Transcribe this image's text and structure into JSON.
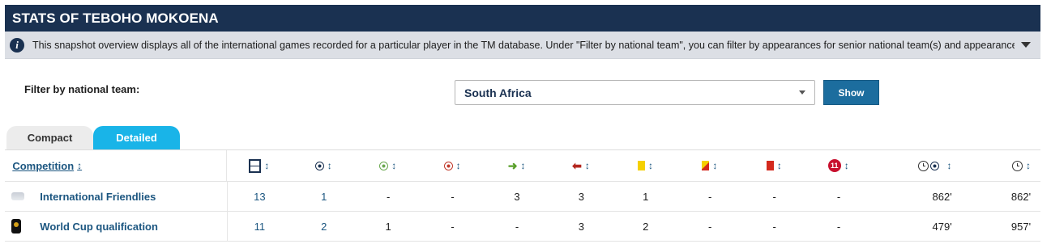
{
  "title": "STATS OF TEBOHO MOKOENA",
  "info": "This snapshot overview displays all of the international games recorded for a particular player in the TM database. Under \"Filter by national team\", you can filter by appearances for senior national team(s) and appearances ...",
  "filter": {
    "label": "Filter by national team:",
    "selected": "South Africa",
    "button": "Show"
  },
  "tabs": {
    "compact": "Compact",
    "detailed": "Detailed"
  },
  "table": {
    "competition_header": "Competition",
    "sort_glyph": "↕",
    "column_icons": [
      "appearances-icon",
      "goals-icon",
      "assists-icon",
      "own-goals-icon",
      "substituted-on-icon",
      "substituted-off-icon",
      "yellow-card-icon",
      "second-yellow-icon",
      "red-card-icon",
      "penalty-goals-icon",
      "minutes-per-goal-icon",
      "minutes-played-icon"
    ],
    "penalty_icon_text": "11",
    "rows": [
      {
        "competition": "International Friendlies",
        "values": [
          "13",
          "1",
          "-",
          "-",
          "3",
          "3",
          "1",
          "-",
          "-",
          "-",
          "862'",
          "862'"
        ]
      },
      {
        "competition": "World Cup qualification",
        "values": [
          "11",
          "2",
          "1",
          "-",
          "-",
          "3",
          "2",
          "-",
          "-",
          "-",
          "479'",
          "957'"
        ]
      }
    ]
  },
  "colors": {
    "title_bg": "#1a3151",
    "accent": "#1c6d9e",
    "tab_active": "#19b4e8"
  }
}
